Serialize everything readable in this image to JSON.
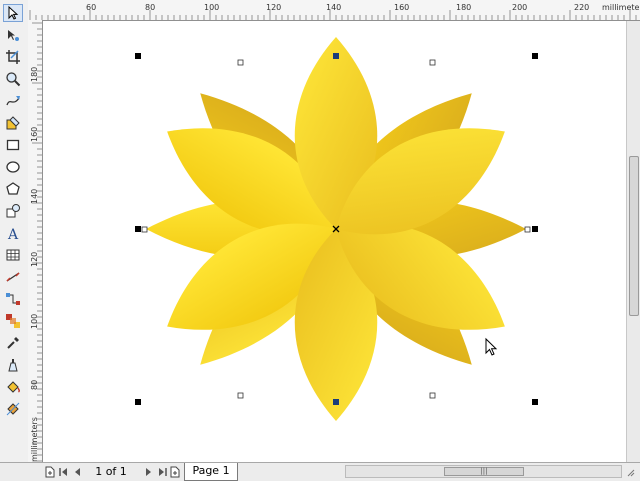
{
  "ruler": {
    "unit": "millimeters",
    "h_labels": [
      "60",
      "80",
      "100",
      "120",
      "140",
      "160",
      "180",
      "200",
      "220"
    ],
    "v_labels": [
      "180",
      "160",
      "140",
      "120",
      "100",
      "80"
    ]
  },
  "toolbox": {
    "tools": [
      {
        "name": "pick-tool-icon",
        "active": true
      },
      {
        "name": "shape-tool-icon"
      },
      {
        "name": "crop-tool-icon"
      },
      {
        "name": "zoom-tool-icon"
      },
      {
        "name": "freehand-tool-icon"
      },
      {
        "name": "smart-fill-tool-icon"
      },
      {
        "name": "rectangle-tool-icon"
      },
      {
        "name": "ellipse-tool-icon"
      },
      {
        "name": "polygon-tool-icon"
      },
      {
        "name": "basic-shapes-tool-icon"
      },
      {
        "name": "text-tool-icon",
        "glyph": "A"
      },
      {
        "name": "table-tool-icon"
      },
      {
        "name": "dimension-tool-icon"
      },
      {
        "name": "connector-tool-icon"
      },
      {
        "name": "interactive-blend-tool-icon"
      },
      {
        "name": "eyedropper-tool-icon"
      },
      {
        "name": "outline-tool-icon"
      },
      {
        "name": "fill-tool-icon"
      },
      {
        "name": "interactive-fill-tool-icon"
      }
    ]
  },
  "statusbar": {
    "page_counter": "1 of 1",
    "page_tab": "Page 1",
    "scroll_grip": "|||"
  },
  "colors": {
    "petal_light": "#ffe83a",
    "petal_mid": "#f6d219",
    "petal_dark": "#d8ab1c",
    "handle": "#000000",
    "center_node": "#1a3c7a"
  }
}
